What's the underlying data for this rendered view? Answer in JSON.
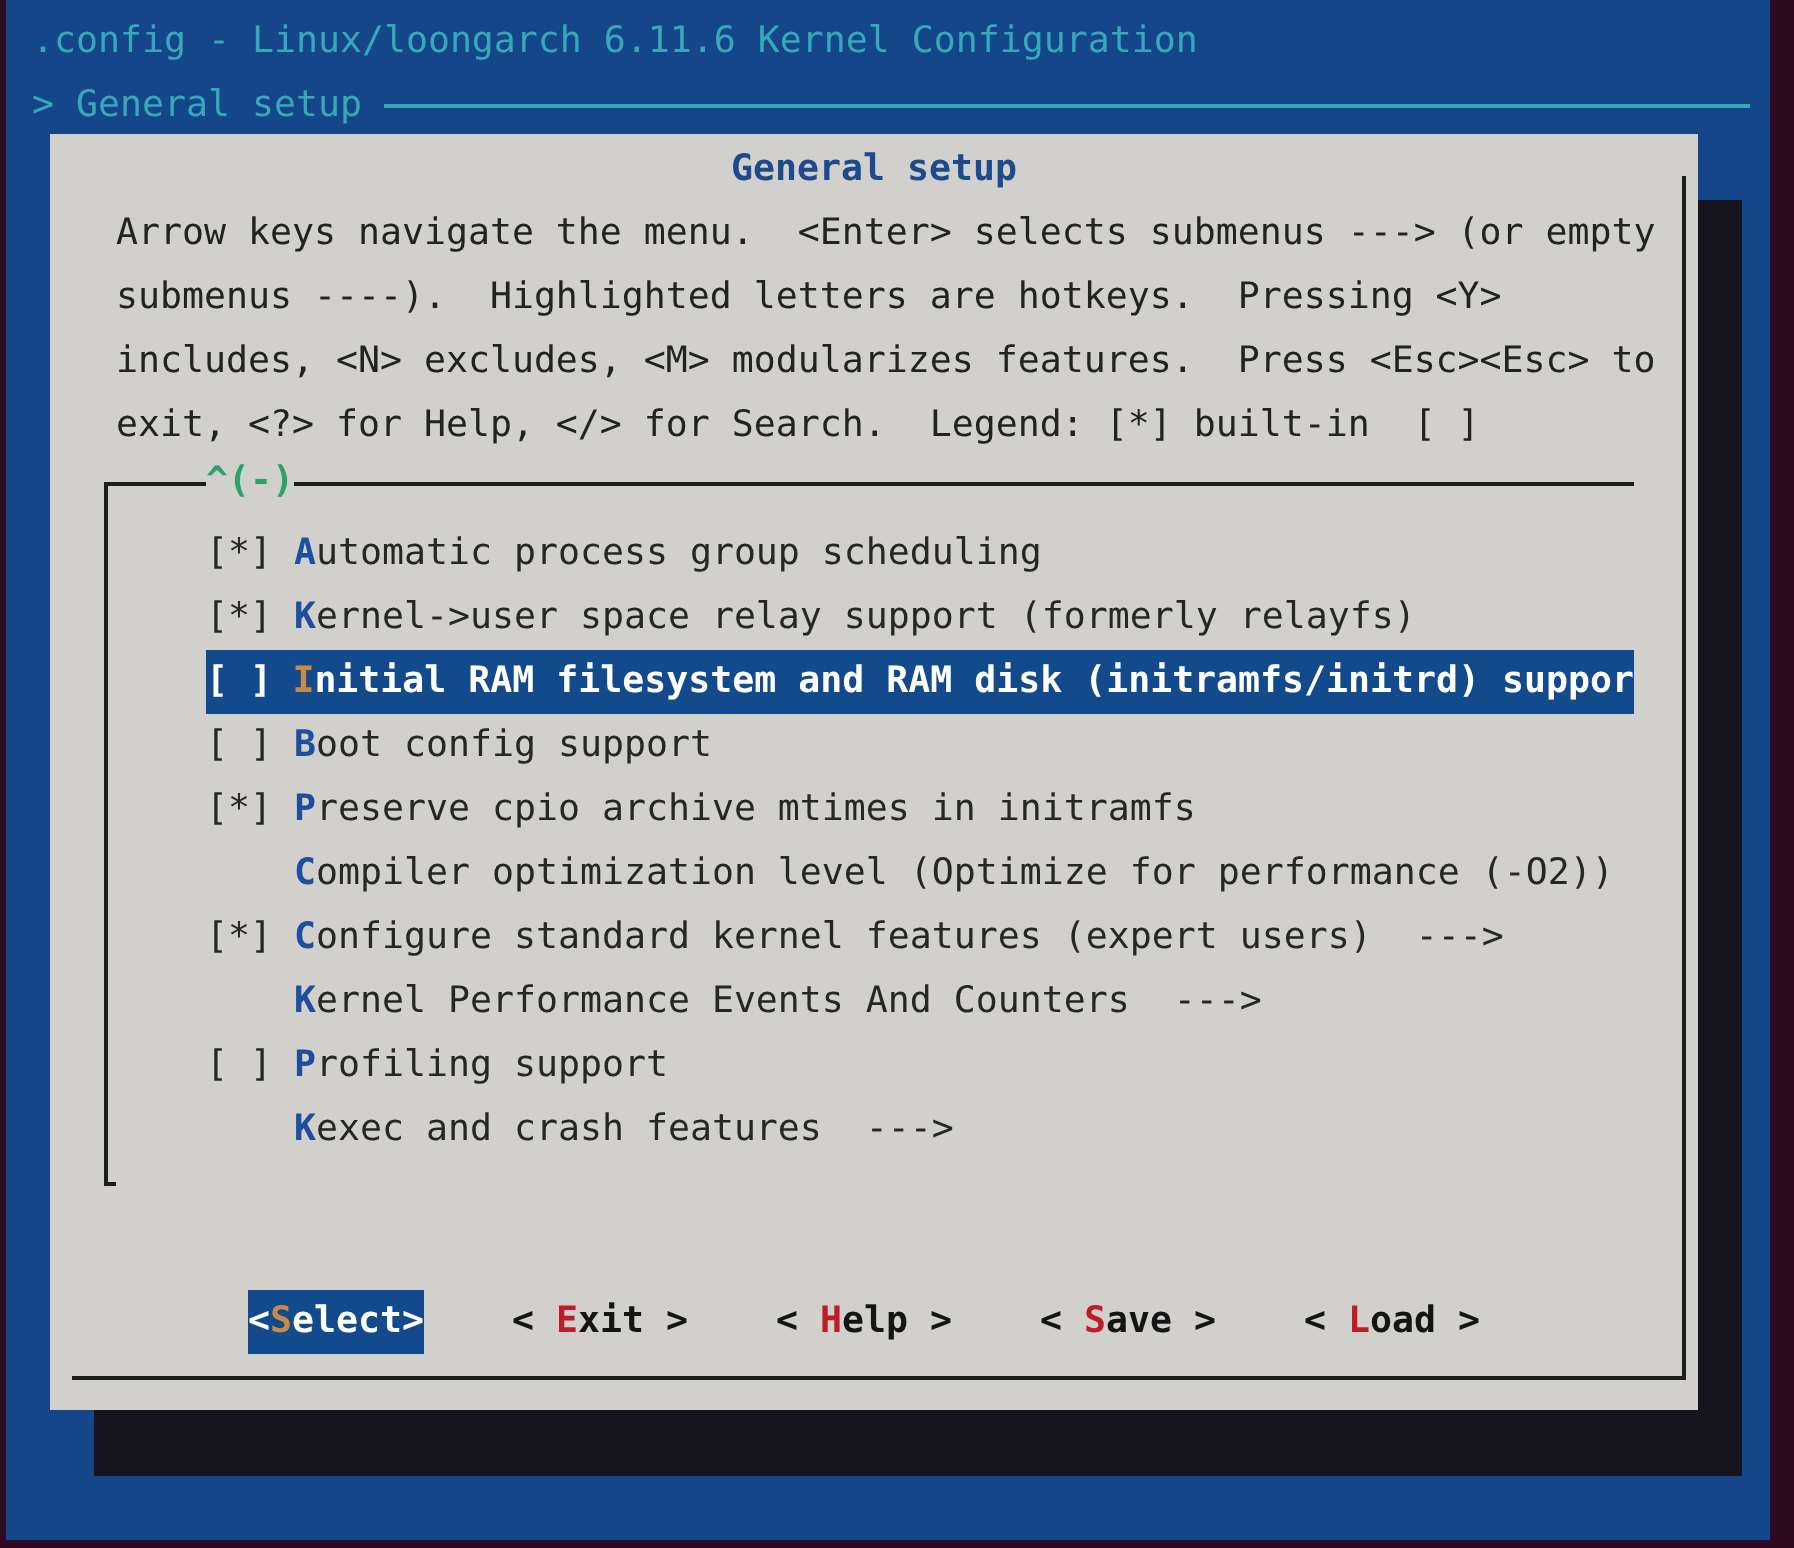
{
  "window": {
    "title": ".config - Linux/loongarch 6.11.6 Kernel Configuration"
  },
  "breadcrumb": "> General setup",
  "dialog": {
    "title": "General setup",
    "help_lines": [
      "Arrow keys navigate the menu.  <Enter> selects submenus ---> (or empty",
      "submenus ----).  Highlighted letters are hotkeys.  Pressing <Y>",
      "includes, <N> excludes, <M> modularizes features.  Press <Esc><Esc> to",
      "exit, <?> for Help, </> for Search.  Legend: [*] built-in  [ ]"
    ],
    "scroll_indicator": "^(-)",
    "items": [
      {
        "kind": "bool",
        "box": "[*]",
        "label": "Automatic process group scheduling",
        "selected": false
      },
      {
        "kind": "bool",
        "box": "[*]",
        "label": "Kernel->user space relay support (formerly relayfs)",
        "selected": false
      },
      {
        "kind": "bool",
        "box": "[ ]",
        "label": "Initial RAM filesystem and RAM disk (initramfs/initrd) suppor",
        "selected": true
      },
      {
        "kind": "bool",
        "box": "[ ]",
        "label": "Boot config support",
        "selected": false
      },
      {
        "kind": "bool",
        "box": "[*]",
        "label": "Preserve cpio archive mtimes in initramfs",
        "selected": false
      },
      {
        "kind": "menu",
        "label": "Compiler optimization level (Optimize for performance (-O2))",
        "selected": false
      },
      {
        "kind": "bool",
        "box": "[*]",
        "label": "Configure standard kernel features (expert users)  --->",
        "selected": false
      },
      {
        "kind": "menu",
        "label": "Kernel Performance Events And Counters  --->",
        "selected": false
      },
      {
        "kind": "bool",
        "box": "[ ]",
        "label": "Profiling support",
        "selected": false
      },
      {
        "kind": "menu",
        "label": "Kexec and crash features  --->",
        "selected": false
      }
    ],
    "buttons": [
      {
        "left": "<",
        "label": "Select",
        "right": ">",
        "selected": true
      },
      {
        "left": "<",
        "label": "Exit",
        "right": ">",
        "selected": false
      },
      {
        "left": "<",
        "label": "Help",
        "right": ">",
        "selected": false
      },
      {
        "left": "<",
        "label": "Save",
        "right": ">",
        "selected": false
      },
      {
        "left": "<",
        "label": "Load",
        "right": ">",
        "selected": false
      }
    ]
  }
}
